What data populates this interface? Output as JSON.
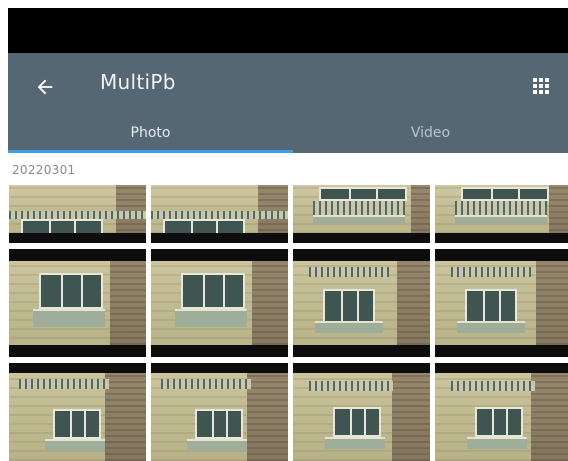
{
  "app_bar": {
    "title": "MultiPb",
    "back_icon": "arrow-left-icon",
    "grid_icon": "grid-view-icon"
  },
  "tabs": [
    {
      "label": "Photo",
      "selected": true
    },
    {
      "label": "Video",
      "selected": false
    }
  ],
  "colors": {
    "app_bar": "#556773",
    "tab_indicator": "#3aa0e8",
    "status_bar": "#000000"
  },
  "gallery": {
    "group_date": "20220301",
    "item_count_visible": 12
  }
}
